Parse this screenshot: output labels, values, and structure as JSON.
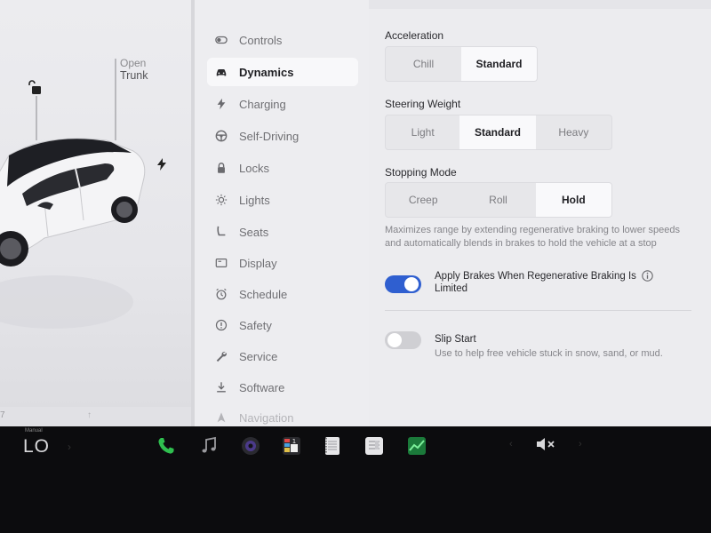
{
  "car": {
    "trunk_label_line1": "Open",
    "trunk_label_line2": "Trunk",
    "bottom_text": "7",
    "bottom_arrow": "↑"
  },
  "sidebar": {
    "items": [
      {
        "label": "Controls",
        "icon": "toggle-icon"
      },
      {
        "label": "Dynamics",
        "icon": "car-icon",
        "active": true
      },
      {
        "label": "Charging",
        "icon": "lightning-icon"
      },
      {
        "label": "Self-Driving",
        "icon": "steering-wheel-icon"
      },
      {
        "label": "Locks",
        "icon": "lock-icon"
      },
      {
        "label": "Lights",
        "icon": "sun-icon"
      },
      {
        "label": "Seats",
        "icon": "seat-icon"
      },
      {
        "label": "Display",
        "icon": "display-icon"
      },
      {
        "label": "Schedule",
        "icon": "alarm-clock-icon"
      },
      {
        "label": "Safety",
        "icon": "alert-circle-icon"
      },
      {
        "label": "Service",
        "icon": "wrench-icon"
      },
      {
        "label": "Software",
        "icon": "download-icon"
      },
      {
        "label": "Navigation",
        "icon": "navigation-icon"
      }
    ]
  },
  "dynamics": {
    "acceleration": {
      "title": "Acceleration",
      "options": [
        "Chill",
        "Standard"
      ],
      "selected": "Standard"
    },
    "steering": {
      "title": "Steering Weight",
      "options": [
        "Light",
        "Standard",
        "Heavy"
      ],
      "selected": "Standard"
    },
    "stopping": {
      "title": "Stopping Mode",
      "options": [
        "Creep",
        "Roll",
        "Hold"
      ],
      "selected": "Hold",
      "description": "Maximizes range by extending regenerative braking to lower speeds and automatically blends in brakes to hold the vehicle at a stop"
    },
    "apply_brakes": {
      "label": "Apply Brakes When Regenerative Braking Is Limited",
      "enabled": true
    },
    "slip_start": {
      "title": "Slip Start",
      "description": "Use to help free vehicle stuck in snow, sand, or mud.",
      "enabled": false
    }
  },
  "taskbar": {
    "climate_mode": "Manual",
    "temperature": "LO",
    "temp_arrow": "›",
    "volume_left_arrow": "‹",
    "volume_right_arrow": "›",
    "dock": [
      "phone-icon",
      "music-icon",
      "camera-icon",
      "calendar-icon",
      "notepad-icon",
      "toybox-icon",
      "stocks-icon"
    ]
  },
  "colors": {
    "toggle_on": "#2f5fd0",
    "phone_green": "#2fbf4f"
  }
}
